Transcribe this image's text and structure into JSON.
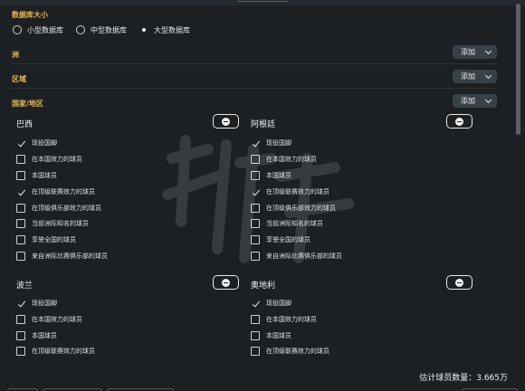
{
  "size_section": {
    "title": "数据库大小",
    "options": [
      {
        "label": "小型数据库",
        "selected": false
      },
      {
        "label": "中型数据库",
        "selected": false
      },
      {
        "label": "大型数据库",
        "selected": true
      }
    ]
  },
  "filters": [
    {
      "title": "洲",
      "button": "添加"
    },
    {
      "title": "区域",
      "button": "添加"
    },
    {
      "title": "国家/地区",
      "button": "添加"
    }
  ],
  "countries": [
    {
      "name": "巴西",
      "options": [
        {
          "label": "现役国脚",
          "checked": true
        },
        {
          "label": "在本国效力的球员",
          "checked": false
        },
        {
          "label": "本国球员",
          "checked": false
        },
        {
          "label": "在顶级联赛效力的球员",
          "checked": true
        },
        {
          "label": "在顶级俱乐部效力的球员",
          "checked": false
        },
        {
          "label": "当前洲际知名的球员",
          "checked": false
        },
        {
          "label": "享誉全国的球员",
          "checked": false
        },
        {
          "label": "来自洲际比赛俱乐部的球员",
          "checked": false
        }
      ]
    },
    {
      "name": "阿根廷",
      "options": [
        {
          "label": "现役国脚",
          "checked": true
        },
        {
          "label": "在本国效力的球员",
          "checked": false
        },
        {
          "label": "本国球员",
          "checked": false
        },
        {
          "label": "在顶级联赛效力的球员",
          "checked": true
        },
        {
          "label": "在顶级俱乐部效力的球员",
          "checked": false
        },
        {
          "label": "当前洲际知名的球员",
          "checked": false
        },
        {
          "label": "享誉全国的球员",
          "checked": false
        },
        {
          "label": "来自洲际比赛俱乐部的球员",
          "checked": false
        }
      ]
    },
    {
      "name": "波兰",
      "options": [
        {
          "label": "现役国脚",
          "checked": true
        },
        {
          "label": "在本国效力的球员",
          "checked": false
        },
        {
          "label": "本国球员",
          "checked": false
        },
        {
          "label": "在顶级联赛效力的球员",
          "checked": false
        }
      ]
    },
    {
      "name": "奥地利",
      "options": [
        {
          "label": "现役国脚",
          "checked": true
        },
        {
          "label": "在本国效力的球员",
          "checked": false
        },
        {
          "label": "本国球员",
          "checked": false
        },
        {
          "label": "在顶级联赛效力的球员",
          "checked": false
        }
      ]
    }
  ],
  "footer": {
    "estimate": "估计球员数量：3.665万"
  }
}
